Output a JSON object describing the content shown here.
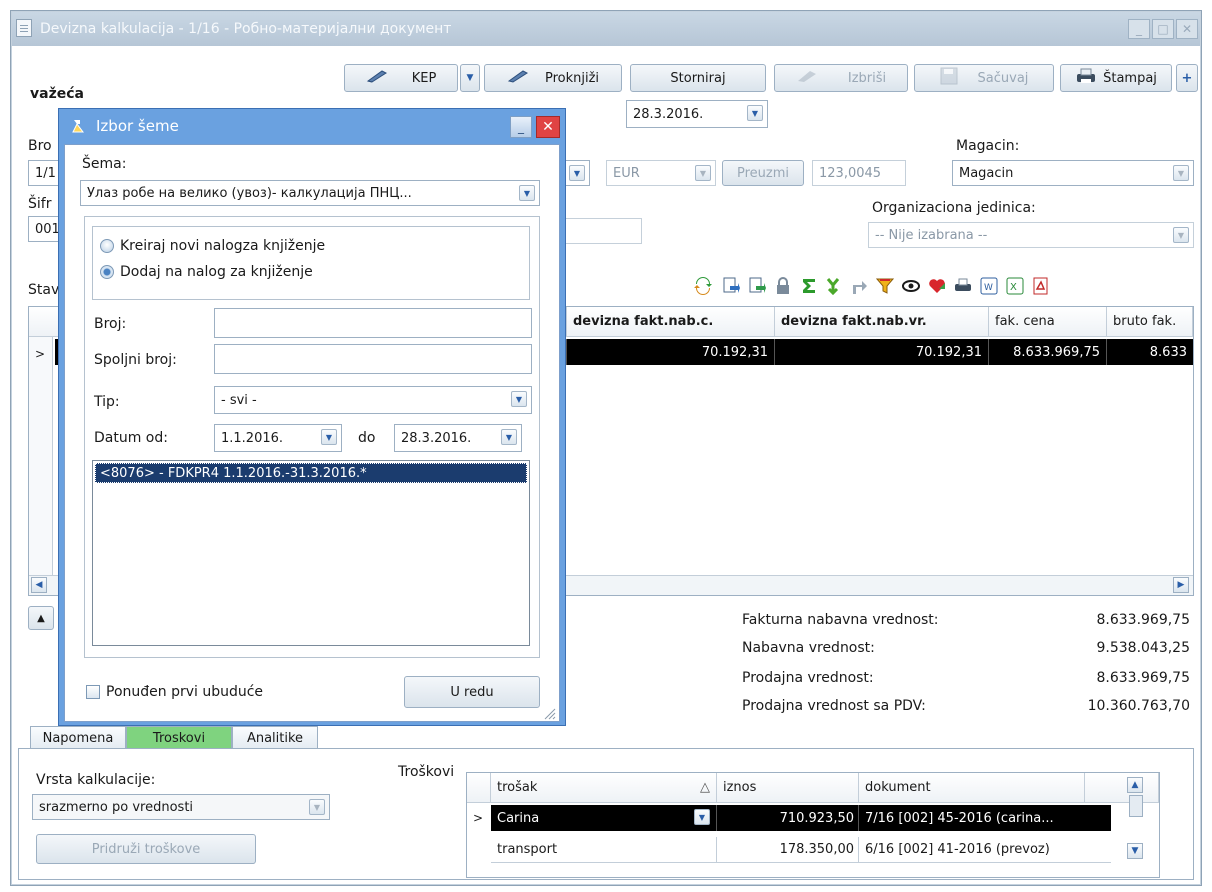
{
  "window": {
    "title": "Devizna kalkulacija - 1/16 - Робно-материјални документ"
  },
  "status": "važeća",
  "toolbar": {
    "kep": "KEP",
    "proknjizi": "Proknjiži",
    "storniraj": "Storniraj",
    "izbrisi": "Izbriši",
    "sacuvaj": "Sačuvaj",
    "stampaj": "Štampaj",
    "plus": "+"
  },
  "header": {
    "date": "28.3.2016.",
    "broj_label_partial": "Bro",
    "broj_value_partial": "1/1",
    "sifra_label_partial": "Šifr",
    "sifra_value_partial": "001",
    "currency": "EUR",
    "preuzmi": "Preuzmi",
    "rate": "123,0045",
    "magacin_label": "Magacin:",
    "magacin_value": "Magacin",
    "org_label": "Organizaciona jedinica:",
    "org_value": "-- Nije izabrana --",
    "stavke_label_partial": "Stav"
  },
  "grid": {
    "columns": [
      "devizna fakt.nab.c.",
      "devizna fakt.nab.vr.",
      "fak. cena",
      "bruto fak."
    ],
    "row": [
      "70.192,31",
      "70.192,31",
      "8.633.969,75",
      "8.633"
    ]
  },
  "totals": [
    {
      "label": "Fakturna nabavna vrednost:",
      "value": "8.633.969,75"
    },
    {
      "label": "Nabavna vrednost:",
      "value": "9.538.043,25"
    },
    {
      "label": "Prodajna vrednost:",
      "value": "8.633.969,75"
    },
    {
      "label": "Prodajna vrednost sa PDV:",
      "value": "10.360.763,70"
    }
  ],
  "tabs": [
    {
      "label": "Napomena"
    },
    {
      "label": "Troskovi"
    },
    {
      "label": "Analitike"
    }
  ],
  "costs": {
    "vrsta_label": "Vrsta kalkulacije:",
    "vrsta_value": "srazmerno po vrednosti",
    "pridruzi": "Pridruži troškove",
    "group_label": "Troškovi",
    "columns": [
      "trošak",
      "iznos",
      "dokument"
    ],
    "rows": [
      {
        "trosak": "Carina",
        "iznos": "710.923,50",
        "dokument": "7/16 [002] 45-2016 (carina..."
      },
      {
        "trosak": "transport",
        "iznos": "178.350,00",
        "dokument": "6/16 [002] 41-2016 (prevoz)"
      }
    ]
  },
  "dialog": {
    "title": "Izbor šeme",
    "sema_label": "Šema:",
    "sema_value": "Улаз робе на велико (увоз)- калкулација ПНЦ...",
    "radio_new": "Kreiraj novi nalogza knjiženje",
    "radio_add": "Dodaj na nalog za knjiženje",
    "broj_label": "Broj:",
    "spoljni_label": "Spoljni broj:",
    "tip_label": "Tip:",
    "tip_value": "- svi -",
    "datum_label": "Datum od:",
    "datum_od": "1.1.2016.",
    "do_label": "do",
    "datum_do": "28.3.2016.",
    "list_item": "<8076> - FDKPR4 1.1.2016.-31.3.2016.*",
    "checkbox_label": "Ponuđen prvi ubuduće",
    "ok_button": "U redu"
  },
  "colors": {
    "dialog_frame": "#6aa1e0",
    "close_button": "#e04343",
    "active_tab": "#7fd37f",
    "selected_row": "#000000"
  }
}
